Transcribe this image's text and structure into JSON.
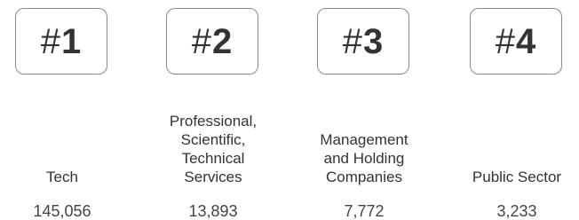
{
  "rankings": [
    {
      "hash": "#",
      "rank": "1",
      "label": "Tech",
      "value": "145,056"
    },
    {
      "hash": "#",
      "rank": "2",
      "label": "Professional,\nScientific,\nTechnical\nServices",
      "value": "13,893"
    },
    {
      "hash": "#",
      "rank": "3",
      "label": "Management\nand Holding\nCompanies",
      "value": "7,772"
    },
    {
      "hash": "#",
      "rank": "4",
      "label": "Public Sector",
      "value": "3,233"
    }
  ],
  "colors": {
    "badge_border": "#8a8a8a",
    "text": "#333333",
    "background": "#ffffff"
  }
}
